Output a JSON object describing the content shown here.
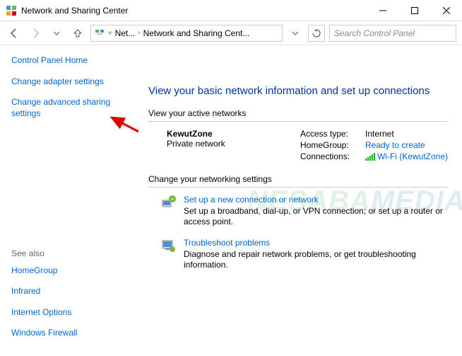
{
  "window": {
    "title": "Network and Sharing Center"
  },
  "breadcrumb": {
    "level1": "Net...",
    "level2": "Network and Sharing Cent..."
  },
  "search": {
    "placeholder": "Search Control Panel"
  },
  "sidebar": {
    "home": "Control Panel Home",
    "adapter": "Change adapter settings",
    "advanced": "Change advanced sharing settings",
    "see_also_label": "See also",
    "see_also": {
      "homegroup": "HomeGroup",
      "infrared": "Infrared",
      "internet": "Internet Options",
      "firewall": "Windows Firewall"
    }
  },
  "main": {
    "heading": "View your basic network information and set up connections",
    "active_label": "View your active networks",
    "network": {
      "name": "KewutZone",
      "type": "Private network",
      "access_label": "Access type:",
      "access_value": "Internet",
      "homegroup_label": "HomeGroup:",
      "homegroup_value": "Ready to create",
      "conn_label": "Connections:",
      "conn_value": "Wi-Fi (KewutZone)"
    },
    "change_label": "Change your networking settings",
    "setup": {
      "title": "Set up a new connection or network",
      "desc": "Set up a broadband, dial-up, or VPN connection; or set up a router or access point."
    },
    "troubleshoot": {
      "title": "Troubleshoot problems",
      "desc": "Diagnose and repair network problems, or get troubleshooting information."
    }
  },
  "watermark": {
    "part1": "NESABA",
    "part2": "MEDIA"
  }
}
